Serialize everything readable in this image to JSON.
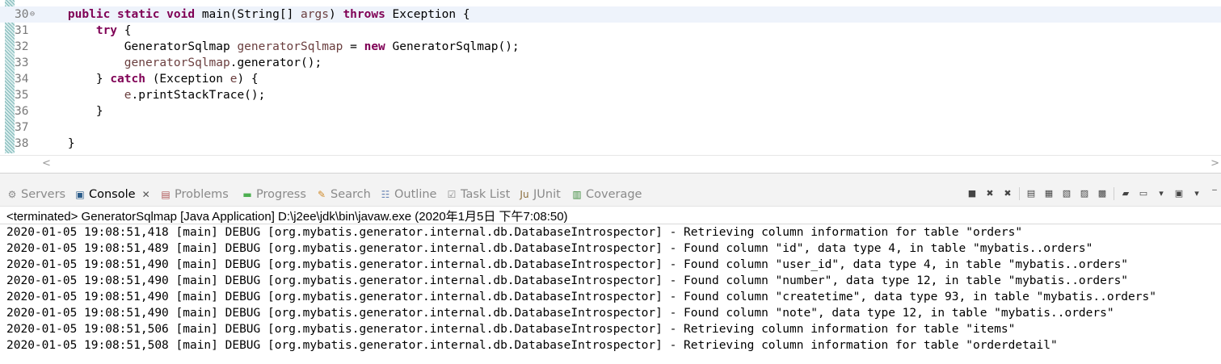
{
  "editor": {
    "lines": [
      {
        "no": "30",
        "fold": "⊖",
        "current": true,
        "segs": [
          {
            "t": "    "
          },
          {
            "t": "public",
            "c": "kw"
          },
          {
            "t": " "
          },
          {
            "t": "static",
            "c": "kw"
          },
          {
            "t": " "
          },
          {
            "t": "void",
            "c": "kw"
          },
          {
            "t": " main(String[] "
          },
          {
            "t": "args",
            "c": "var"
          },
          {
            "t": ") "
          },
          {
            "t": "throws",
            "c": "kw"
          },
          {
            "t": " Exception {"
          }
        ]
      },
      {
        "no": "31",
        "segs": [
          {
            "t": "        "
          },
          {
            "t": "try",
            "c": "kw"
          },
          {
            "t": " {"
          }
        ]
      },
      {
        "no": "32",
        "segs": [
          {
            "t": "            GeneratorSqlmap "
          },
          {
            "t": "generatorSqlmap",
            "c": "var"
          },
          {
            "t": " = "
          },
          {
            "t": "new",
            "c": "kw"
          },
          {
            "t": " GeneratorSqlmap();"
          }
        ]
      },
      {
        "no": "33",
        "segs": [
          {
            "t": "            "
          },
          {
            "t": "generatorSqlmap",
            "c": "var"
          },
          {
            "t": ".generator();"
          }
        ]
      },
      {
        "no": "34",
        "segs": [
          {
            "t": "        } "
          },
          {
            "t": "catch",
            "c": "kw"
          },
          {
            "t": " (Exception "
          },
          {
            "t": "e",
            "c": "var"
          },
          {
            "t": ") {"
          }
        ]
      },
      {
        "no": "35",
        "segs": [
          {
            "t": "            "
          },
          {
            "t": "e",
            "c": "var"
          },
          {
            "t": ".printStackTrace();"
          }
        ]
      },
      {
        "no": "36",
        "segs": [
          {
            "t": "        }"
          }
        ]
      },
      {
        "no": "37",
        "segs": []
      },
      {
        "no": "38",
        "segs": [
          {
            "t": "    }"
          }
        ]
      }
    ]
  },
  "tabs": [
    {
      "name": "servers",
      "label": "Servers",
      "icon": "servers-icon",
      "glyph": "⚙",
      "color": "#8a8a8a"
    },
    {
      "name": "console",
      "label": "Console",
      "icon": "console-icon",
      "glyph": "▣",
      "color": "#2c5d8a",
      "active": true
    },
    {
      "name": "problems",
      "label": "Problems",
      "icon": "problems-icon",
      "glyph": "▤",
      "color": "#b05a5a"
    },
    {
      "name": "progress",
      "label": "Progress",
      "icon": "progress-icon",
      "glyph": "▬",
      "color": "#4caf50"
    },
    {
      "name": "search",
      "label": "Search",
      "icon": "search-icon",
      "glyph": "✎",
      "color": "#d08a2a"
    },
    {
      "name": "outline",
      "label": "Outline",
      "icon": "outline-icon",
      "glyph": "☷",
      "color": "#6a86b5"
    },
    {
      "name": "task-list",
      "label": "Task List",
      "icon": "task-list-icon",
      "glyph": "☑",
      "color": "#8a8a8a"
    },
    {
      "name": "junit",
      "label": "JUnit",
      "icon": "junit-icon",
      "glyph": "Ju",
      "color": "#8a6d3b"
    },
    {
      "name": "coverage",
      "label": "Coverage",
      "icon": "coverage-icon",
      "glyph": "▥",
      "color": "#3b8a3b"
    }
  ],
  "console": {
    "header": "<terminated> GeneratorSqlmap [Java Application] D:\\j2ee\\jdk\\bin\\javaw.exe (2020年1月5日 下午7:08:50)",
    "lines": [
      "2020-01-05 19:08:51,418 [main] DEBUG [org.mybatis.generator.internal.db.DatabaseIntrospector] - Retrieving column information for table \"orders\"",
      "2020-01-05 19:08:51,489 [main] DEBUG [org.mybatis.generator.internal.db.DatabaseIntrospector] - Found column \"id\", data type 4, in table \"mybatis..orders\"",
      "2020-01-05 19:08:51,490 [main] DEBUG [org.mybatis.generator.internal.db.DatabaseIntrospector] - Found column \"user_id\", data type 4, in table \"mybatis..orders\"",
      "2020-01-05 19:08:51,490 [main] DEBUG [org.mybatis.generator.internal.db.DatabaseIntrospector] - Found column \"number\", data type 12, in table \"mybatis..orders\"",
      "2020-01-05 19:08:51,490 [main] DEBUG [org.mybatis.generator.internal.db.DatabaseIntrospector] - Found column \"createtime\", data type 93, in table \"mybatis..orders\"",
      "2020-01-05 19:08:51,490 [main] DEBUG [org.mybatis.generator.internal.db.DatabaseIntrospector] - Found column \"note\", data type 12, in table \"mybatis..orders\"",
      "2020-01-05 19:08:51,506 [main] DEBUG [org.mybatis.generator.internal.db.DatabaseIntrospector] - Retrieving column information for table \"items\"",
      "2020-01-05 19:08:51,508 [main] DEBUG [org.mybatis.generator.internal.db.DatabaseIntrospector] - Retrieving column information for table \"orderdetail\""
    ]
  },
  "toolbar": [
    {
      "name": "terminate-button",
      "glyph": "■"
    },
    {
      "name": "remove-launch-button",
      "glyph": "✖"
    },
    {
      "name": "remove-all-terminated-button",
      "glyph": "✖"
    },
    {
      "sep": true
    },
    {
      "name": "clear-console-button",
      "glyph": "▤"
    },
    {
      "name": "scroll-lock-button",
      "glyph": "▦"
    },
    {
      "name": "word-wrap-button",
      "glyph": "▧"
    },
    {
      "name": "show-on-stdout-button",
      "glyph": "▨"
    },
    {
      "name": "show-on-stderr-button",
      "glyph": "▩"
    },
    {
      "sep": true
    },
    {
      "name": "pin-console-button",
      "glyph": "▰"
    },
    {
      "name": "display-selected-console-button",
      "glyph": "▭"
    },
    {
      "name": "display-dropdown-button",
      "glyph": "▾"
    },
    {
      "name": "open-console-button",
      "glyph": "▣"
    },
    {
      "name": "open-console-dropdown-button",
      "glyph": "▾"
    },
    {
      "name": "minimize-button",
      "glyph": "‾"
    }
  ]
}
